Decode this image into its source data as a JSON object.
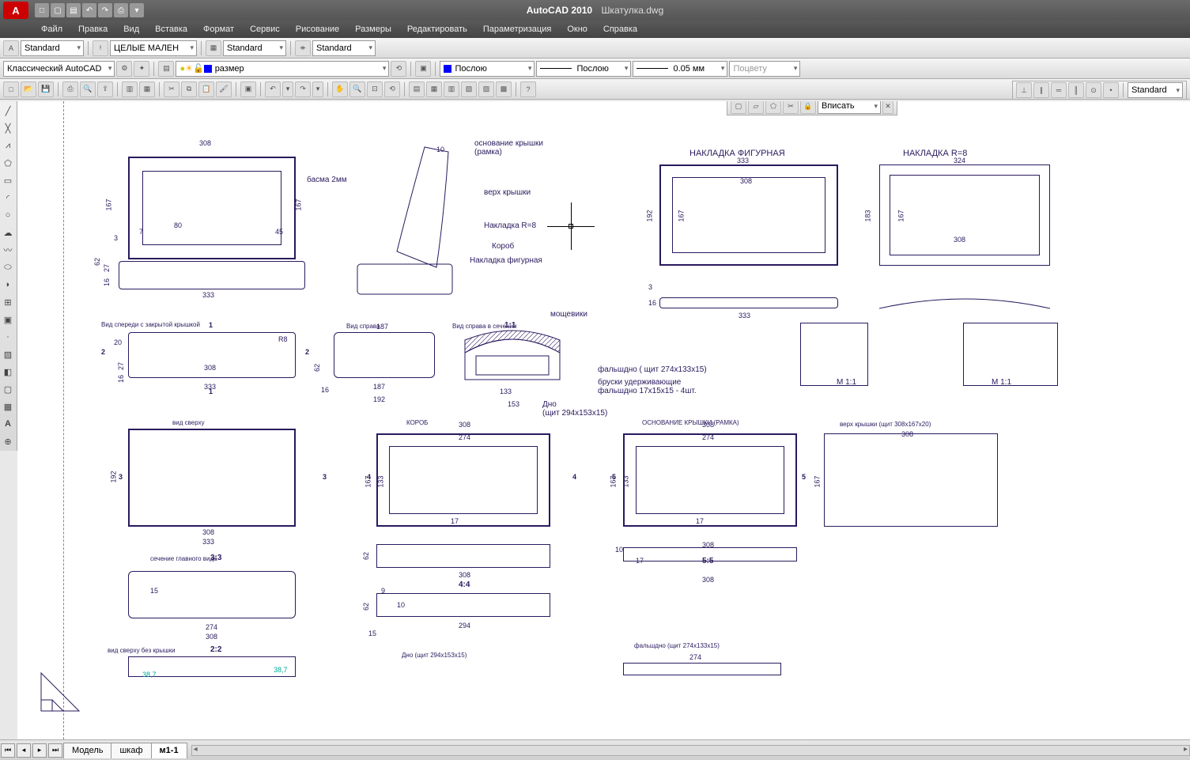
{
  "title": {
    "app": "AutoCAD 2010",
    "file": "Шкатулка.dwg",
    "logo": "A"
  },
  "qat": [
    "□",
    "▢",
    "▤",
    "↶",
    "↷",
    "⎙",
    "▾"
  ],
  "menu": [
    "Файл",
    "Правка",
    "Вид",
    "Вставка",
    "Формат",
    "Сервис",
    "Рисование",
    "Размеры",
    "Редактировать",
    "Параметризация",
    "Окно",
    "Справка"
  ],
  "row1": {
    "text_style": "Standard",
    "dim_style": "ЦЕЛЫЕ МАЛЕН",
    "table_style": "Standard",
    "ml_style": "Standard"
  },
  "row2": {
    "workspace": "Классический AutoCAD",
    "layer": "размер",
    "color": "Послою",
    "ltype": "Послою",
    "lweight": "0.05 мм",
    "plot_style": "Поцвету"
  },
  "viewport": {
    "fit": "Вписать"
  },
  "top_right_std": "Standard",
  "tabs": {
    "nav": [
      "⏮",
      "◂",
      "▸",
      "⏭"
    ],
    "items": [
      {
        "label": "Модель",
        "active": false
      },
      {
        "label": "шкаф",
        "active": false
      },
      {
        "label": "м1-1",
        "active": true
      }
    ]
  },
  "drawing": {
    "labels": {
      "nakladka_fig": "НАКЛАДКА ФИГУРНАЯ",
      "nakladka_r8": "НАКЛАДКА R=8",
      "osn_kryshki": "основание крышки\n(рамка)",
      "verkh_kryshki": "верх крышки",
      "nakl_r8_s": "Накладка R=8",
      "korob_s": "Короб",
      "nakl_fig_s": "Накладка фигурная",
      "basma": "басма 2мм",
      "moscheviki": "мощевики",
      "falshdno": "фальшдно ( щит 274х133х15)",
      "bruski": "бруски удерживающие\nфальшдно 17х15х15 - 4шт.",
      "dno": "Дно\n(щит 294х153х15)",
      "vid_speredi": "Вид спереди с закрытой крышкой",
      "vid_sprava": "Вид справа",
      "vid_sprava_sech": "Вид справа в сечении",
      "scale11": "1:1",
      "m11": "M 1:1",
      "vid_sverhu": "вид сверху",
      "korob_cap": "КОРОБ",
      "osn_cap": "ОСНОВАНИЕ КРЫШКИ (РАМКА)",
      "verkh_cap": "верх крышки (щит 308х167х20)",
      "sech_gl": "сечение главного вида",
      "r33": "3:3",
      "r44": "4:4",
      "r55": "5:5",
      "r22": "2:2",
      "vid_bezkr": "вид сверху без крышки",
      "dno_cap": "Дно (щит 294х153х15)",
      "falsh_cap": "фальшдно (щит 274х133х15)"
    },
    "dims": {
      "d308": "308",
      "d333": "333",
      "d324": "324",
      "d192": "192",
      "d167": "167",
      "d183": "183",
      "d274": "274",
      "d294": "294",
      "d153": "153",
      "d133": "133",
      "d62": "62",
      "d27": "27",
      "d16": "16",
      "d3": "3",
      "d45": "45",
      "d80": "80",
      "d7": "7",
      "d10": "10",
      "d187": "187",
      "d17": "17",
      "d20": "20",
      "d9": "9",
      "d15": "15",
      "r8": "R8",
      "n1": "1",
      "n2": "2",
      "n3": "3",
      "n4": "4",
      "n5": "5",
      "n387": "38,7"
    }
  }
}
